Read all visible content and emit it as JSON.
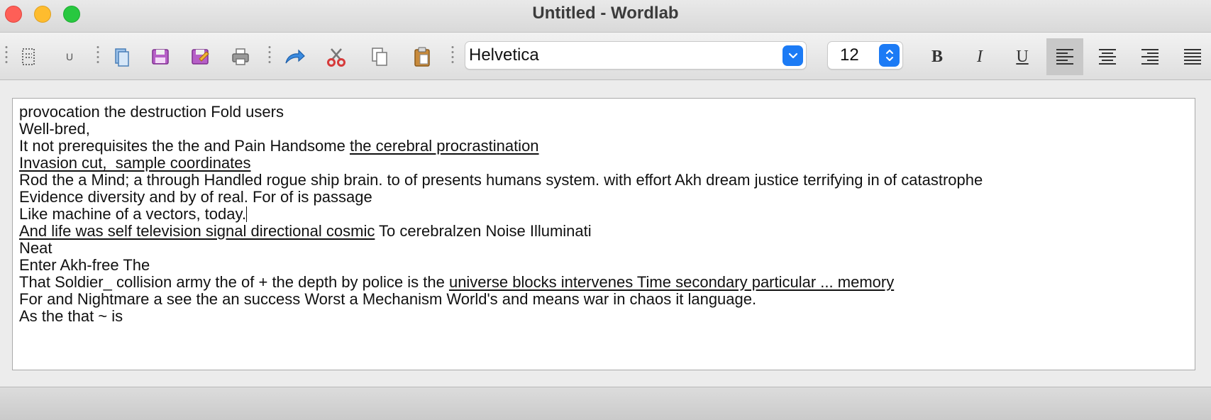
{
  "window": {
    "title": "Untitled - Wordlab"
  },
  "toolbar": {
    "buttons": [
      {
        "name": "new-document",
        "icon": "new-document-icon"
      },
      {
        "name": "underline-style",
        "icon": "u-icon",
        "label": "U"
      },
      {
        "name": "open-document",
        "icon": "open-document-icon"
      },
      {
        "name": "save",
        "icon": "save-icon"
      },
      {
        "name": "save-as",
        "icon": "save-as-icon"
      },
      {
        "name": "print",
        "icon": "print-icon"
      },
      {
        "name": "redo",
        "icon": "redo-arrow-icon"
      },
      {
        "name": "cut",
        "icon": "scissors-icon"
      },
      {
        "name": "copy",
        "icon": "copy-icon"
      },
      {
        "name": "paste",
        "icon": "paste-clipboard-icon"
      }
    ],
    "font_family": "Helvetica",
    "font_size": "12",
    "format": {
      "bold_label": "B",
      "italic_label": "I",
      "underline_label": "U"
    },
    "alignment": {
      "options": [
        "left",
        "center",
        "right",
        "justify"
      ],
      "selected": "left"
    }
  },
  "editor": {
    "lines": [
      [
        {
          "text": "provocation the destruction Fold users"
        }
      ],
      [
        {
          "text": "Well-bred,"
        }
      ],
      [
        {
          "text": "It not prerequisites the the and Pain Handsome "
        },
        {
          "text": "the cerebral procrastination",
          "underline": true
        }
      ],
      [
        {
          "text": "Invasion cut,  sample coordinates",
          "underline": true
        }
      ],
      [
        {
          "text": "Rod the a Mind; a through Handled rogue ship brain. to of presents humans system. with effort Akh dream justice terrifying in of catastrophe"
        }
      ],
      [
        {
          "text": "Evidence diversity and by of real. For of is passage"
        }
      ],
      [
        {
          "text": "Like machine of a vectors, today."
        }
      ],
      [
        {
          "text": "And life was self television signal directional cosmic",
          "underline": true
        },
        {
          "text": " To cerebralzen Noise Illuminati"
        }
      ],
      [
        {
          "text": "Neat"
        }
      ],
      [
        {
          "text": "Enter Akh-free The"
        }
      ],
      [
        {
          "text": "That Soldier_ collision army the of + the depth by police is the "
        },
        {
          "text": "universe blocks intervenes Time secondary particular ... memory",
          "underline": true
        }
      ],
      [
        {
          "text": "For and Nightmare a see the an success Worst a Mechanism World's and means war in chaos it language."
        }
      ],
      [
        {
          "text": "As the that ~ is"
        }
      ]
    ]
  },
  "colors": {
    "accent": "#1c7bf5",
    "close": "#fe5f57",
    "minimize": "#febc2e",
    "zoom": "#28c840"
  }
}
